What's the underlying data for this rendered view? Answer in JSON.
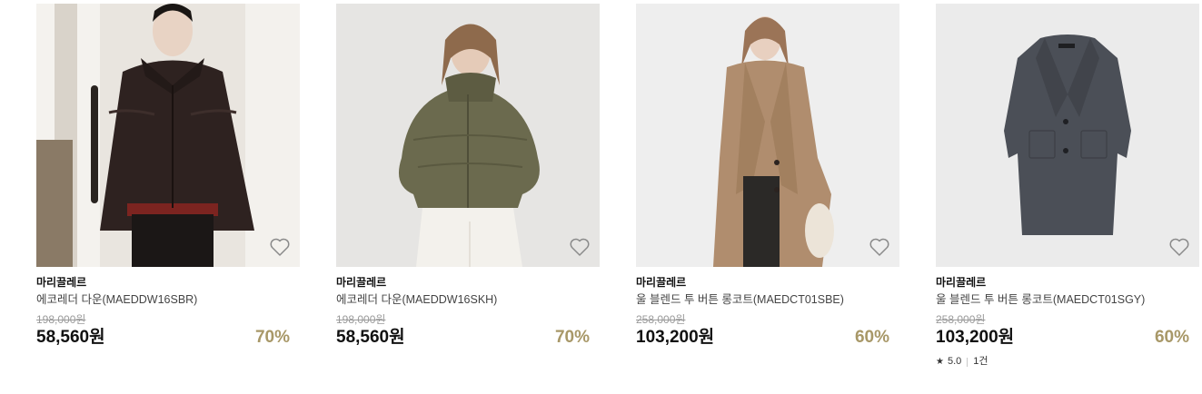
{
  "products": [
    {
      "brand": "마리끌레르",
      "name": "에코레더 다운(MAEDDW16SBR)",
      "original_price": "198,000원",
      "price": "58,560원",
      "discount": "70%",
      "image_icon": "cropped-brown-leather-puffer-photo",
      "wishlist_icon": "heart-outline-icon"
    },
    {
      "brand": "마리끌레르",
      "name": "에코레더 다운(MAEDDW16SKH)",
      "original_price": "198,000원",
      "price": "58,560원",
      "discount": "70%",
      "image_icon": "cropped-khaki-puffer-photo",
      "wishlist_icon": "heart-outline-icon"
    },
    {
      "brand": "마리끌레르",
      "name": "울 블렌드 투 버튼 롱코트(MAEDCT01SBE)",
      "original_price": "258,000원",
      "price": "103,200원",
      "discount": "60%",
      "image_icon": "beige-long-coat-photo",
      "wishlist_icon": "heart-outline-icon"
    },
    {
      "brand": "마리끌레르",
      "name": "울 블렌드 투 버튼 롱코트(MAEDCT01SGY)",
      "original_price": "258,000원",
      "price": "103,200원",
      "discount": "60%",
      "image_icon": "grey-long-coat-photo",
      "wishlist_icon": "heart-outline-icon",
      "rating": "5.0",
      "review_count": "1건"
    }
  ],
  "colors": {
    "discount": "#a89868",
    "price": "#111111",
    "original_price": "#9a9a9a"
  }
}
